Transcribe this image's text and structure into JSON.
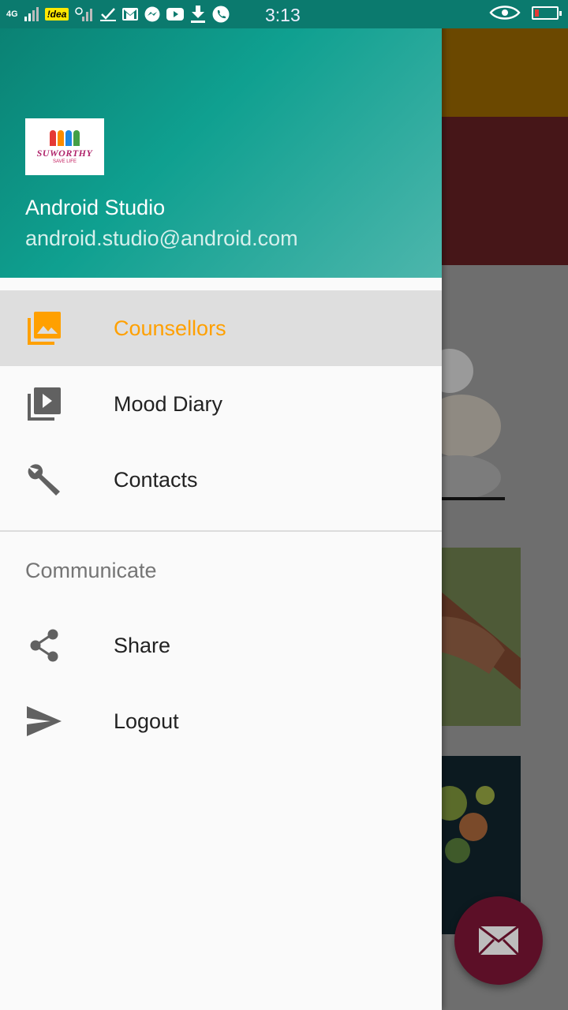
{
  "status_bar": {
    "network": "4G",
    "carrier": "!dea",
    "time": "3:13"
  },
  "drawer": {
    "header": {
      "logo_text": "SUWORTHY",
      "logo_subtext": "SAVE LIFE",
      "user_name": "Android Studio",
      "user_email": "android.studio@android.com"
    },
    "items": [
      {
        "label": "Counsellors",
        "icon": "photo-library-icon",
        "selected": true
      },
      {
        "label": "Mood Diary",
        "icon": "video-library-icon",
        "selected": false
      },
      {
        "label": "Contacts",
        "icon": "wrench-icon",
        "selected": false
      }
    ],
    "section_title": "Communicate",
    "section_items": [
      {
        "label": "Share",
        "icon": "share-icon"
      },
      {
        "label": "Logout",
        "icon": "send-icon"
      }
    ]
  },
  "colors": {
    "header_start": "#0a7f71",
    "header_end": "#4db6ac",
    "selected_text": "#ffa000",
    "fab": "#5c0f27"
  }
}
